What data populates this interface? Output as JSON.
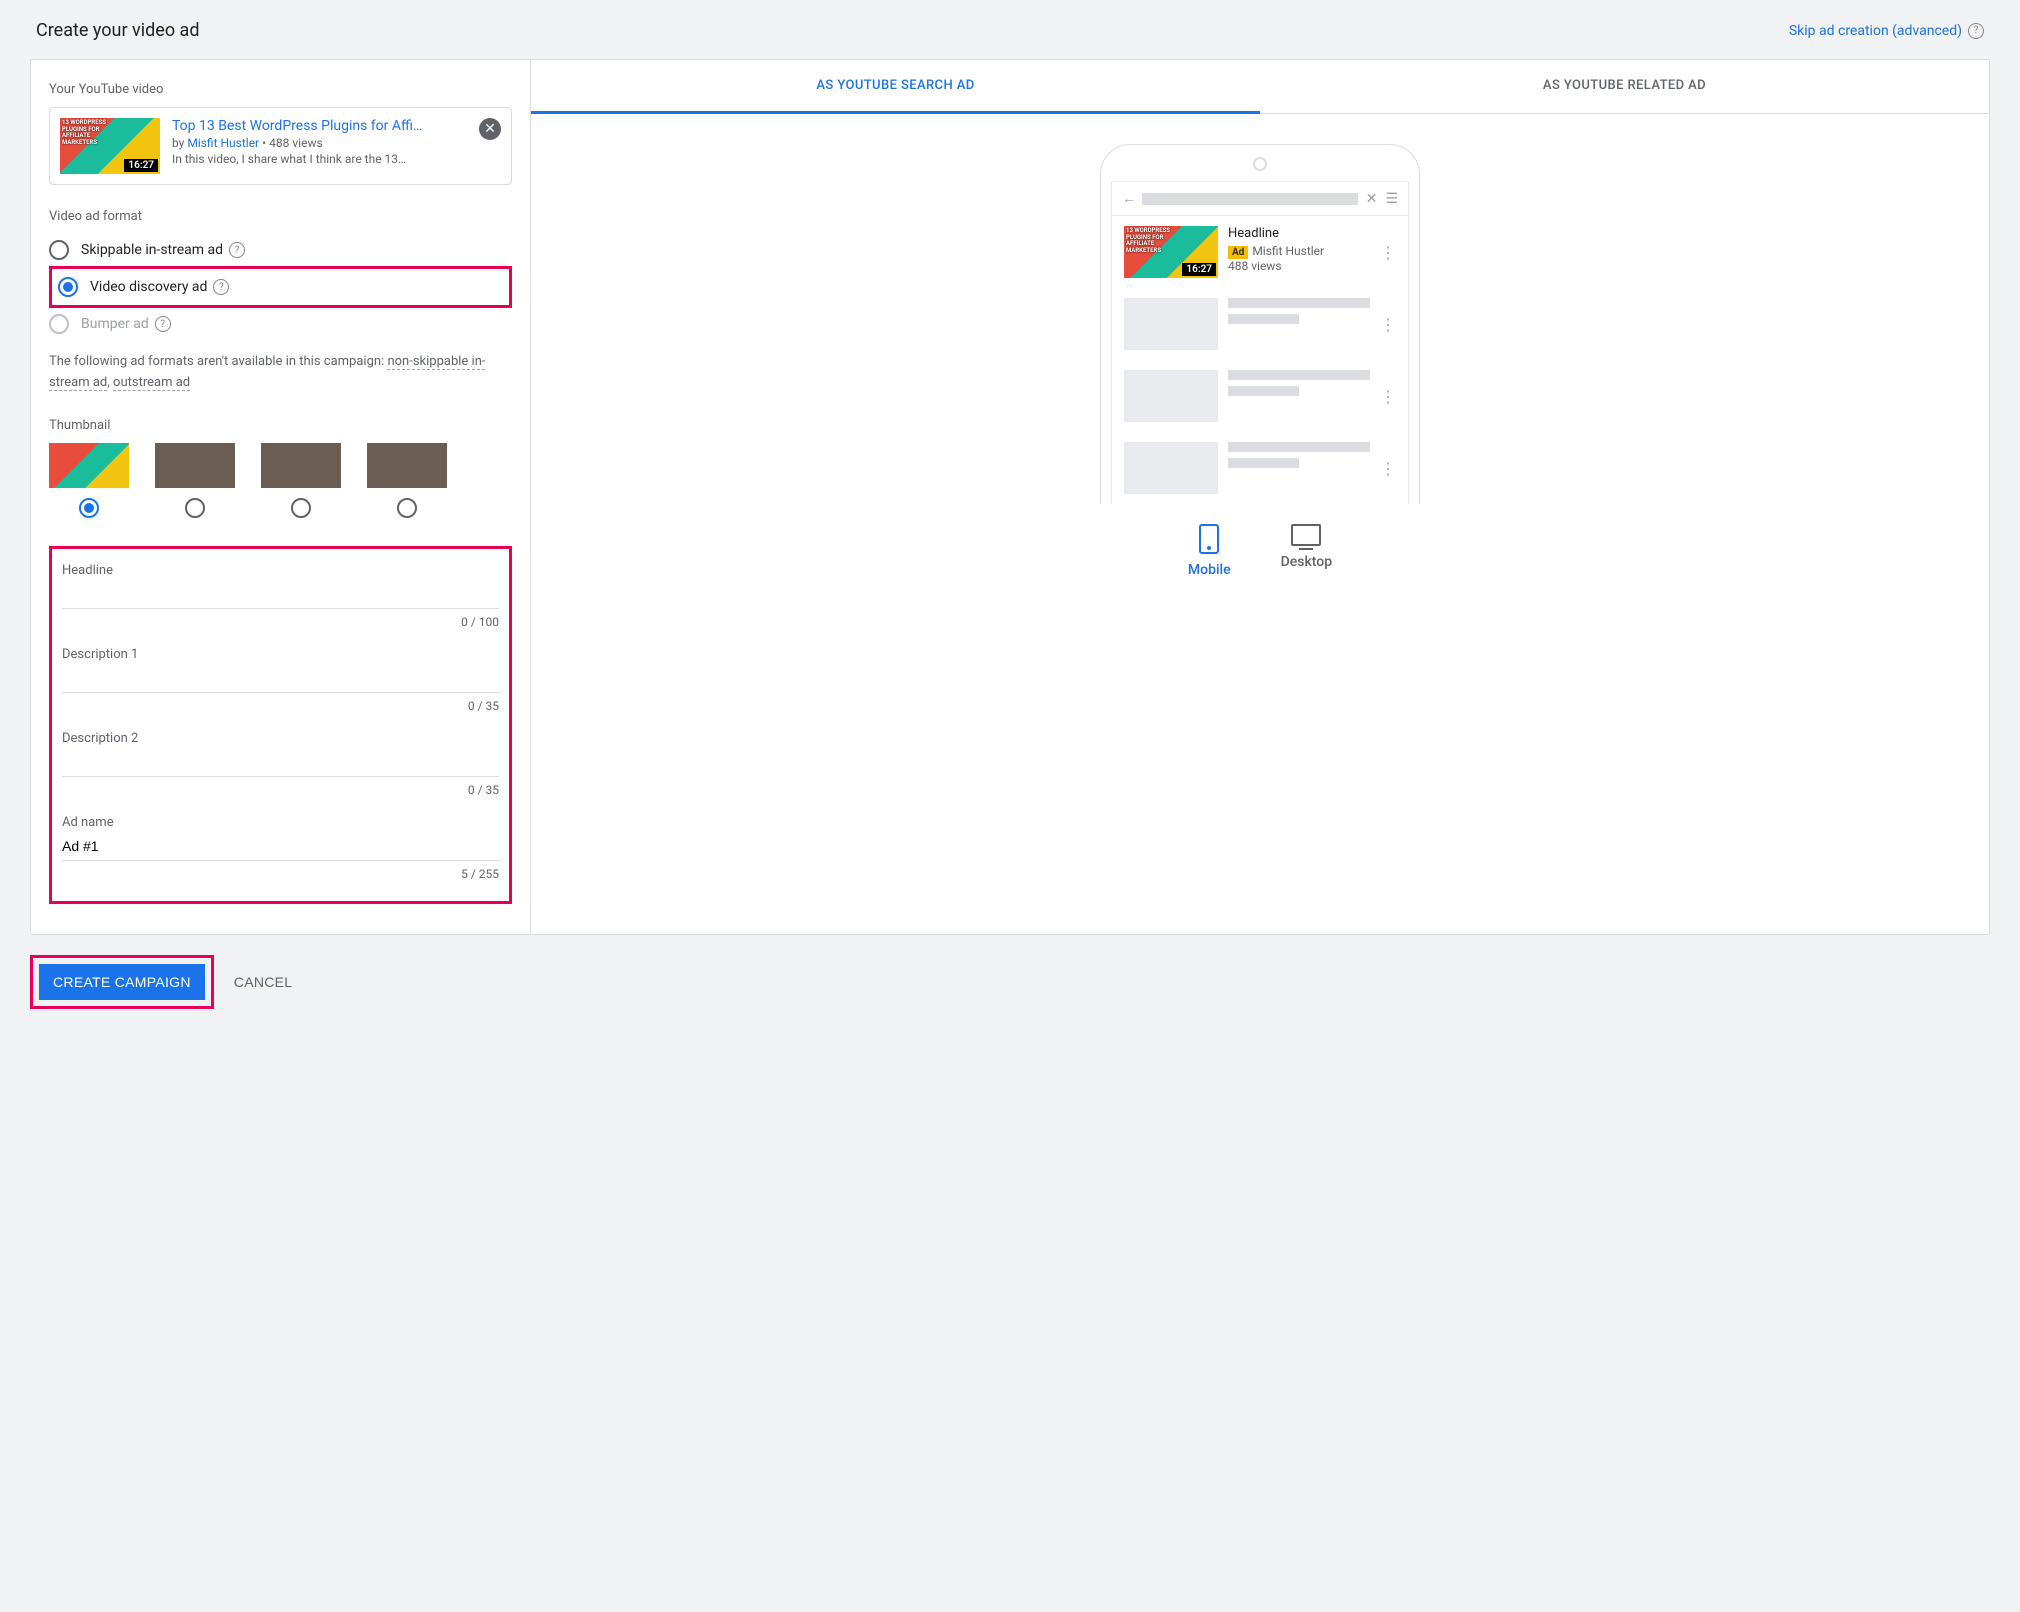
{
  "header": {
    "title": "Create your video ad",
    "skip_label": "Skip ad creation (advanced)"
  },
  "video": {
    "section_label": "Your YouTube video",
    "title": "Top 13 Best WordPress Plugins for Affi…",
    "by_prefix": "by",
    "channel": "Misfit Hustler",
    "views": "488 views",
    "description": "In this video, I share what I think are the 13…",
    "duration": "16:27",
    "thumb_text": "13 WORDPRESS PLUGINS FOR AFFILIATE MARKETERS"
  },
  "format": {
    "section_label": "Video ad format",
    "options": {
      "skippable": "Skippable in-stream ad",
      "discovery": "Video discovery ad",
      "bumper": "Bumper ad"
    },
    "note_prefix": "The following ad formats aren't available in this campaign: ",
    "note_link1": "non-skippable in-stream ad",
    "note_sep": ", ",
    "note_link2": "outstream ad"
  },
  "thumbnail": {
    "section_label": "Thumbnail"
  },
  "fields": {
    "headline": {
      "label": "Headline",
      "counter": "0 / 100"
    },
    "desc1": {
      "label": "Description 1",
      "counter": "0 / 35"
    },
    "desc2": {
      "label": "Description 2",
      "counter": "0 / 35"
    },
    "adname": {
      "label": "Ad name",
      "value": "Ad #1",
      "counter": "5 / 255"
    }
  },
  "preview": {
    "tabs": {
      "search": "AS YOUTUBE SEARCH AD",
      "related": "AS YOUTUBE RELATED AD"
    },
    "result": {
      "headline": "Headline",
      "ad_badge": "Ad",
      "channel": "Misfit Hustler",
      "views": "488 views",
      "duration": "16:27"
    },
    "device": {
      "mobile": "Mobile",
      "desktop": "Desktop"
    }
  },
  "footer": {
    "create": "CREATE CAMPAIGN",
    "cancel": "CANCEL"
  }
}
